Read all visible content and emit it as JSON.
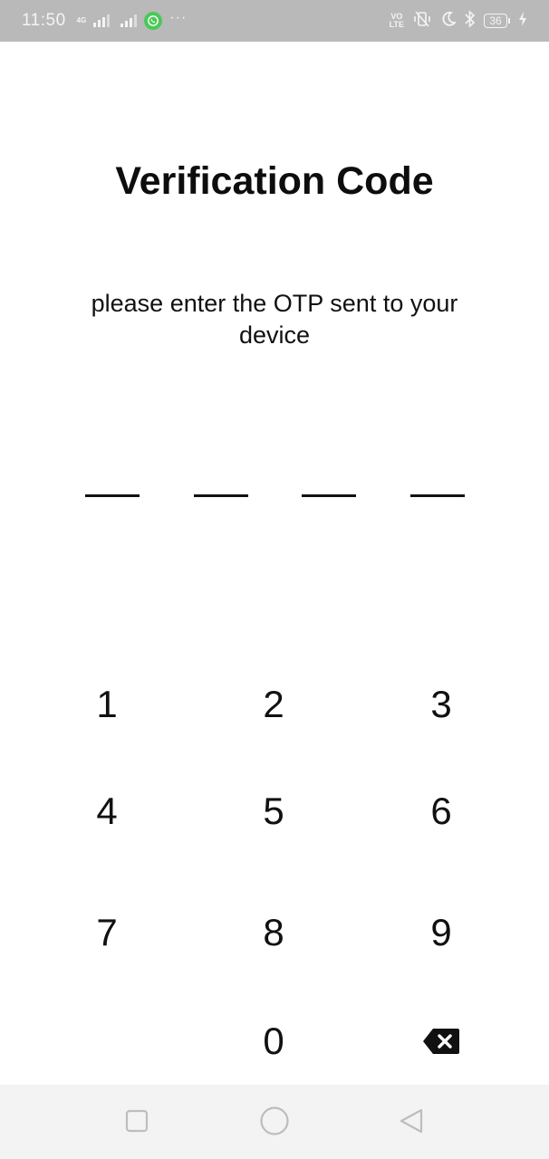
{
  "status_bar": {
    "time": "11:50",
    "network_type": "4G",
    "volte_label_top": "VO",
    "volte_label_bottom": "LTE",
    "battery_level": "36",
    "icons": [
      "signal-icon",
      "signal-icon",
      "whatsapp-icon",
      "more-dots-icon",
      "volte-icon",
      "vibrate-icon",
      "moon-icon",
      "bluetooth-icon",
      "battery-icon",
      "charging-icon"
    ],
    "more_dots": "···"
  },
  "screen": {
    "title": "Verification Code",
    "subtitle": "please enter the OTP sent to your device",
    "otp_length": 4
  },
  "keypad": {
    "keys": [
      "1",
      "2",
      "3",
      "4",
      "5",
      "6",
      "7",
      "8",
      "9",
      "0"
    ],
    "backspace_icon": "backspace-icon"
  },
  "nav_bar": {
    "icons": [
      "recent-apps-icon",
      "home-icon",
      "back-icon"
    ]
  }
}
